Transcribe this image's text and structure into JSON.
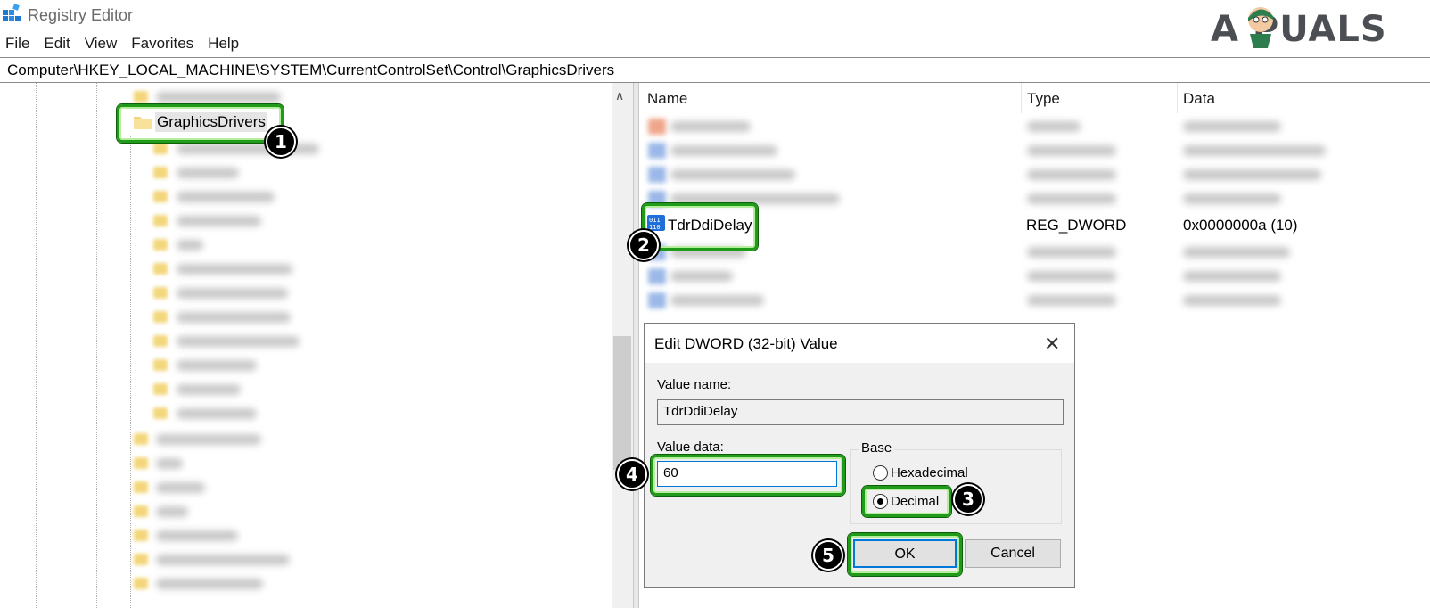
{
  "window": {
    "title": "Registry Editor",
    "menu": [
      "File",
      "Edit",
      "View",
      "Favorites",
      "Help"
    ],
    "address": "Computer\\HKEY_LOCAL_MACHINE\\SYSTEM\\CurrentControlSet\\Control\\GraphicsDrivers",
    "logo": "A  PUALS"
  },
  "tree": {
    "selected_key": "GraphicsDrivers",
    "expand_arrow": "chevron-down-icon"
  },
  "values_list": {
    "columns": [
      "Name",
      "Type",
      "Data"
    ],
    "highlighted": {
      "name": "TdrDdiDelay",
      "type": "REG_DWORD",
      "data": "0x0000000a (10)"
    }
  },
  "dialog": {
    "title": "Edit DWORD (32-bit) Value",
    "value_name_label": "Value name:",
    "value_name": "TdrDdiDelay",
    "value_data_label": "Value data:",
    "value_data": "60",
    "base_label": "Base",
    "base_options": [
      "Hexadecimal",
      "Decimal"
    ],
    "base_selected": "Decimal",
    "ok_label": "OK",
    "cancel_label": "Cancel"
  },
  "steps": [
    "1",
    "2",
    "3",
    "4",
    "5"
  ],
  "colors": {
    "highlight_border": "#1f9b19",
    "folder": "#f3d67a",
    "reg_icon": "#1e6fd9",
    "focus_blue": "#0078d7"
  }
}
